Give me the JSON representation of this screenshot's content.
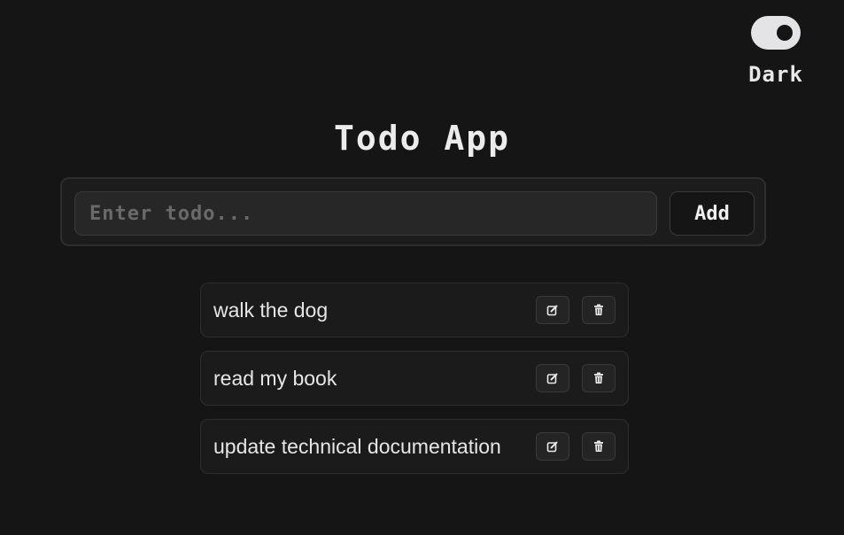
{
  "theme": {
    "label": "Dark",
    "enabled": true
  },
  "header": {
    "title": "Todo App"
  },
  "form": {
    "input_value": "",
    "input_placeholder": "Enter todo...",
    "add_label": "Add"
  },
  "todos": [
    {
      "text": "walk the dog"
    },
    {
      "text": "read my book"
    },
    {
      "text": "update technical documentation"
    }
  ],
  "icons": {
    "edit": "edit-icon",
    "delete": "trash-icon"
  }
}
